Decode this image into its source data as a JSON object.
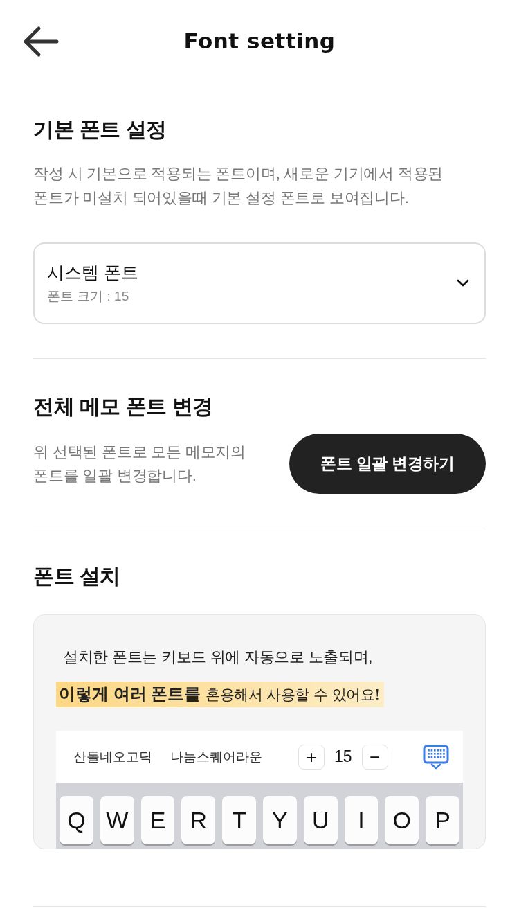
{
  "header": {
    "title": "Font setting"
  },
  "sections": [
    {
      "kind": "dropdown",
      "title": "기본 폰트 설정",
      "description": "작성 시 기본으로 적용되는 폰트이며, 새로운 기기에서 적용된 폰트가 미설치 되어있을때 기본 설정 폰트로 보여집니다.",
      "dropdown": {
        "value": "시스템 폰트",
        "detail": "폰트 크기 : 15"
      }
    },
    {
      "kind": "action",
      "title": "전체 메모 폰트 변경",
      "description": "위 선택된 폰트로 모든 메모지의 폰트를 일괄 변경합니다.",
      "button": "폰트 일괄 변경하기"
    },
    {
      "kind": "install",
      "title": "폰트 설치",
      "preview": {
        "caption": "설치한 폰트는 키보드 위에 자동으로 노출되며,",
        "highlight": "**이렇게 여러 폰트를** *혼용해서 사용할 수 있어요!*",
        "fonts": [
          "산돌네오고딕",
          "나눔스퀘어라운"
        ],
        "increase": "+",
        "size": "15",
        "decrease": "−",
        "keys": [
          "Q",
          "W",
          "E",
          "R",
          "T",
          "Y",
          "U",
          "I",
          "O",
          "P"
        ]
      }
    }
  ]
}
